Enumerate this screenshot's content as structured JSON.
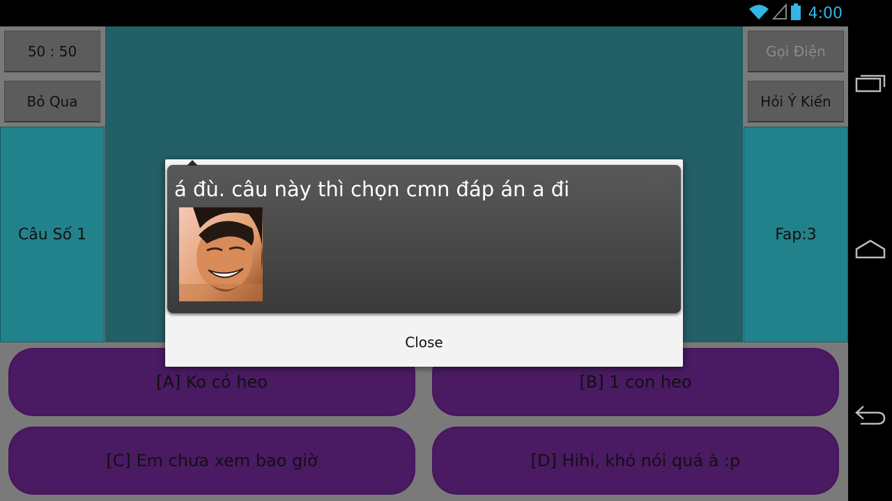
{
  "status_bar": {
    "time": "4:00",
    "icons": [
      "wifi-icon",
      "cell-signal-icon",
      "battery-icon"
    ],
    "accent_color": "#33b5e5"
  },
  "lifelines": {
    "fifty_fifty": "50 : 50",
    "skip": "Bỏ Qua",
    "call": "Gọi Điện",
    "ask_opinion": "Hỏi Ý Kiến"
  },
  "game": {
    "question_number": "Câu Số 1",
    "fap": "Fap:3"
  },
  "answers": {
    "a": "[A] Ko có heo",
    "b": "[B] 1 con heo",
    "c": "[C] Em chưa xem bao giờ",
    "d": "[D] Hihi, khó nói quá à :p"
  },
  "dialog": {
    "message": "á đù. câu này thì chọn cmn đáp án a  đi",
    "close_label": "Close"
  },
  "nav_bar": {
    "icons": [
      "recent-apps-icon",
      "home-icon",
      "back-icon"
    ]
  },
  "colors": {
    "teal_panel": "#22828c",
    "answer_purple": "#4a1a62",
    "button_gray": "#5c5c5c"
  }
}
